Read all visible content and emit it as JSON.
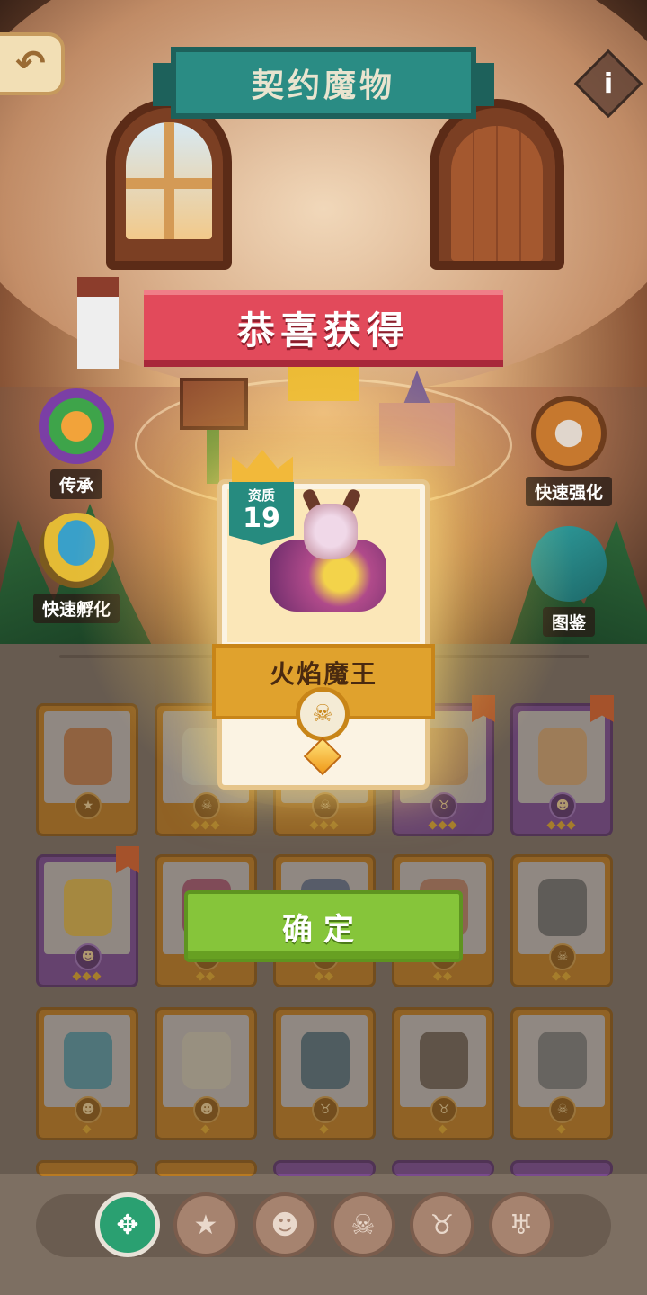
{
  "header": {
    "title": "契约魔物",
    "back_icon": "back-arrow-icon",
    "info_label": "i"
  },
  "side_buttons": {
    "inherit": "传承",
    "quick_hatch": "快速孵化",
    "quick_enhance": "快速强化",
    "atlas": "图鉴"
  },
  "congrats": "恭喜获得",
  "reward": {
    "quality_label": "资质",
    "quality_value": "19",
    "name": "火焰魔王",
    "type_icon": "demon-face-icon",
    "type_glyph": "☠",
    "rarity_stars": 1
  },
  "confirm_label": "确定",
  "cards": [
    {
      "color": "orange",
      "type": "egg-icon",
      "glyph": "★",
      "stars": "",
      "flag": false,
      "art": "#b9662a"
    },
    {
      "color": "orange",
      "type": "skull-icon",
      "glyph": "☠",
      "stars": "◆◆◆",
      "flag": false,
      "art": "#c8c9c0"
    },
    {
      "color": "orange",
      "type": "skull-icon",
      "glyph": "☠",
      "stars": "◆◆◆",
      "flag": false,
      "art": "#b58a3a"
    },
    {
      "color": "purple",
      "type": "ram-icon",
      "glyph": "♉",
      "stars": "◆◆◆",
      "flag": true,
      "art": "#c48a4a"
    },
    {
      "color": "purple",
      "type": "monster-icon",
      "glyph": "☻",
      "stars": "◆◆◆",
      "flag": true,
      "art": "#d39a5a"
    },
    {
      "color": "purple",
      "type": "monster-icon",
      "glyph": "☻",
      "stars": "◆◆◆",
      "flag": true,
      "art": "#e3b22a"
    },
    {
      "color": "orange",
      "type": "demon-icon",
      "glyph": "☠",
      "stars": "◆◆",
      "flag": false,
      "art": "#9a3a5a"
    },
    {
      "color": "orange",
      "type": "demon-icon",
      "glyph": "☠",
      "stars": "◆◆",
      "flag": false,
      "art": "#4a5a7a"
    },
    {
      "color": "orange",
      "type": "ram-icon",
      "glyph": "♉",
      "stars": "◆◆",
      "flag": false,
      "art": "#b06a4a"
    },
    {
      "color": "orange",
      "type": "skull-icon",
      "glyph": "☠",
      "stars": "◆◆",
      "flag": false,
      "art": "#5a5a5a"
    },
    {
      "color": "orange",
      "type": "monster-icon",
      "glyph": "☻",
      "stars": "◆",
      "flag": false,
      "art": "#3a8a9a"
    },
    {
      "color": "orange",
      "type": "monster-icon",
      "glyph": "☻",
      "stars": "◆",
      "flag": false,
      "art": "#c8c0a8"
    },
    {
      "color": "orange",
      "type": "ram-icon",
      "glyph": "♉",
      "stars": "◆",
      "flag": false,
      "art": "#3a5a6a"
    },
    {
      "color": "orange",
      "type": "ram-icon",
      "glyph": "♉",
      "stars": "◆",
      "flag": false,
      "art": "#5a4a3a"
    },
    {
      "color": "orange",
      "type": "demon-icon",
      "glyph": "☠",
      "stars": "◆",
      "flag": false,
      "art": "#6a6a6a"
    }
  ],
  "filters": [
    {
      "name": "filter-all",
      "icon": "all-icon",
      "glyph": "✥",
      "active": true
    },
    {
      "name": "filter-egg",
      "icon": "egg-star-icon",
      "glyph": "★",
      "active": false
    },
    {
      "name": "filter-monster",
      "icon": "monster-face-icon",
      "glyph": "☻",
      "active": false
    },
    {
      "name": "filter-skull",
      "icon": "skull-icon",
      "glyph": "☠",
      "active": false
    },
    {
      "name": "filter-ram",
      "icon": "ram-head-icon",
      "glyph": "♉",
      "active": false
    },
    {
      "name": "filter-demon",
      "icon": "demon-head-icon",
      "glyph": "♅",
      "active": false
    }
  ],
  "colors": {
    "teal": "#2a8c84",
    "ribbon_red": "#e24a5b",
    "confirm_green": "#86c53a",
    "card_orange": "#b87a22",
    "card_purple": "#7a4a8e",
    "quality_teal": "#268b7f"
  }
}
